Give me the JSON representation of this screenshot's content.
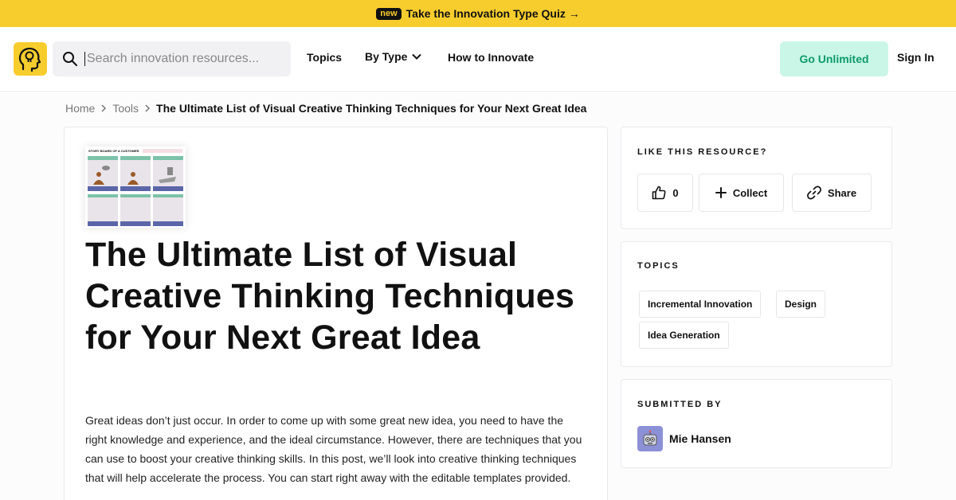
{
  "promo": {
    "badge": "new",
    "text": "Take the Innovation Type Quiz →"
  },
  "header": {
    "search_placeholder": "Search innovation resources...",
    "nav": {
      "topics": "Topics",
      "by_type": "By Type",
      "how_to": "How to Innovate"
    },
    "unlimited_label": "Go Unlimited",
    "signin_label": "Sign In"
  },
  "breadcrumb": {
    "home": "Home",
    "tools": "Tools",
    "current": "The Ultimate List of Visual Creative Thinking Techniques for Your Next Great Idea"
  },
  "article": {
    "thumbnail_title": "STORY BOARD OF A CUSTOMER",
    "title": "The Ultimate List of Visual Creative Thinking Techniques for Your Next Great Idea",
    "body": "Great ideas don’t just occur. In order to come up with some great new idea, you need to have the right knowledge and experience, and the ideal circumstance. However, there are techniques that you can use to boost your creative thinking skills. In this post, we’ll look into creative thinking techniques that will help accelerate the process. You can start right away with the editable templates provided."
  },
  "like_card": {
    "heading": "LIKE THIS RESOURCE?",
    "like_count": "0",
    "collect_label": "Collect",
    "share_label": "Share"
  },
  "topics_card": {
    "heading": "TOPICS",
    "tags": [
      "Incremental Innovation",
      "Design",
      "Idea Generation"
    ]
  },
  "submitted_card": {
    "heading": "SUBMITTED BY",
    "author": "Mie Hansen"
  },
  "colors": {
    "brand_yellow": "#f7cd2e",
    "unlimited_bg": "#c9f6e6",
    "unlimited_text": "#0d9a6b",
    "avatar_bg": "#8c90d6"
  },
  "icons": {
    "logo": "head-lightbulb-icon",
    "search": "search-icon",
    "chevron": "chevron-down-icon",
    "like": "thumbs-up-icon",
    "collect": "plus-icon",
    "share": "link-icon",
    "avatar": "robot-icon"
  }
}
